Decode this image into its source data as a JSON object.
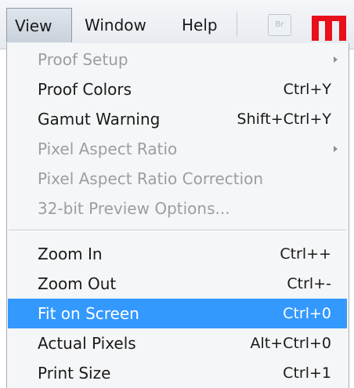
{
  "menubar": {
    "items": [
      {
        "label": "View"
      },
      {
        "label": "Window"
      },
      {
        "label": "Help"
      }
    ],
    "bridge_button_label": "Br",
    "brand_logo_icon": "brand-logo-icon"
  },
  "menu": {
    "items": [
      {
        "label": "Proof Setup",
        "shortcut": "",
        "enabled": false,
        "submenu": true
      },
      {
        "label": "Proof Colors",
        "shortcut": "Ctrl+Y",
        "enabled": true
      },
      {
        "label": "Gamut Warning",
        "shortcut": "Shift+Ctrl+Y",
        "enabled": true
      },
      {
        "label": "Pixel Aspect Ratio",
        "shortcut": "",
        "enabled": false,
        "submenu": true
      },
      {
        "label": "Pixel Aspect Ratio Correction",
        "shortcut": "",
        "enabled": false
      },
      {
        "label": "32-bit Preview Options...",
        "shortcut": "",
        "enabled": false
      },
      {
        "label": "Zoom In",
        "shortcut": "Ctrl++",
        "enabled": true
      },
      {
        "label": "Zoom Out",
        "shortcut": "Ctrl+-",
        "enabled": true
      },
      {
        "label": "Fit on Screen",
        "shortcut": "Ctrl+0",
        "enabled": true,
        "highlighted": true
      },
      {
        "label": "Actual Pixels",
        "shortcut": "Alt+Ctrl+0",
        "enabled": true
      },
      {
        "label": "Print Size",
        "shortcut": "Ctrl+1",
        "enabled": true
      }
    ]
  },
  "colors": {
    "highlight": "#3399ff",
    "disabled_text": "#9a9ea4",
    "brand_red": "#e8101a"
  }
}
